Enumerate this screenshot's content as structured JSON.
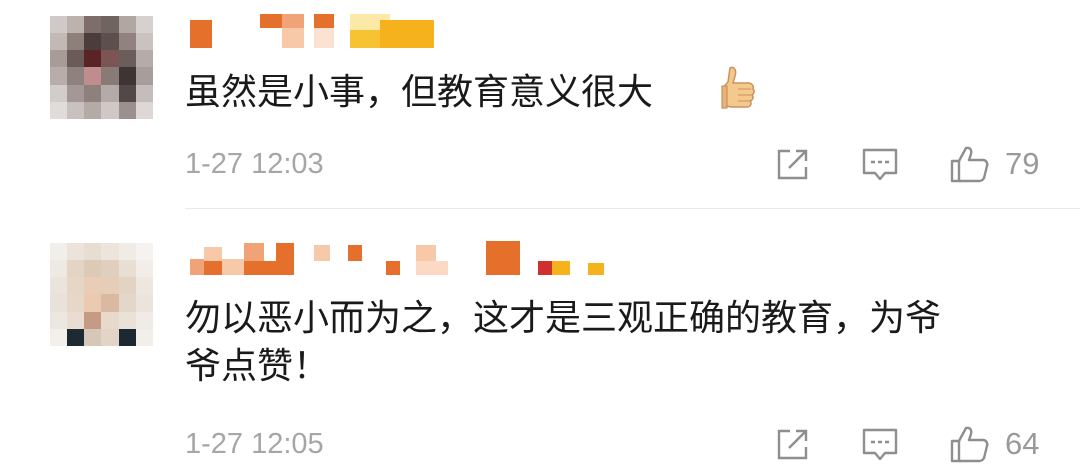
{
  "comments": [
    {
      "author_name": "",
      "text_lines": [
        "虽然是小事，但教育意义很大"
      ],
      "emoji": "thumbs-up-emoji",
      "time": "1-27 12:03",
      "actions": {
        "share_icon": "share-icon",
        "reply_icon": "comment-icon",
        "like_icon": "like-icon"
      },
      "like_count": "79"
    },
    {
      "author_name": "",
      "text_lines": [
        "勿以恶小而为之，这才是三观正确的教育，为爷",
        "爷点赞！"
      ],
      "time": "1-27 12:05",
      "actions": {
        "share_icon": "share-icon",
        "reply_icon": "comment-icon",
        "like_icon": "like-icon"
      },
      "like_count": "64"
    }
  ],
  "colors": {
    "text": "#1a1a1a",
    "meta": "#a6a6a6",
    "icon": "#8e8e8e",
    "divider": "#e9e9e9",
    "name_orange": "#e5702b",
    "name_peach": "#f7c9a8",
    "name_yellow": "#f6b21d"
  }
}
